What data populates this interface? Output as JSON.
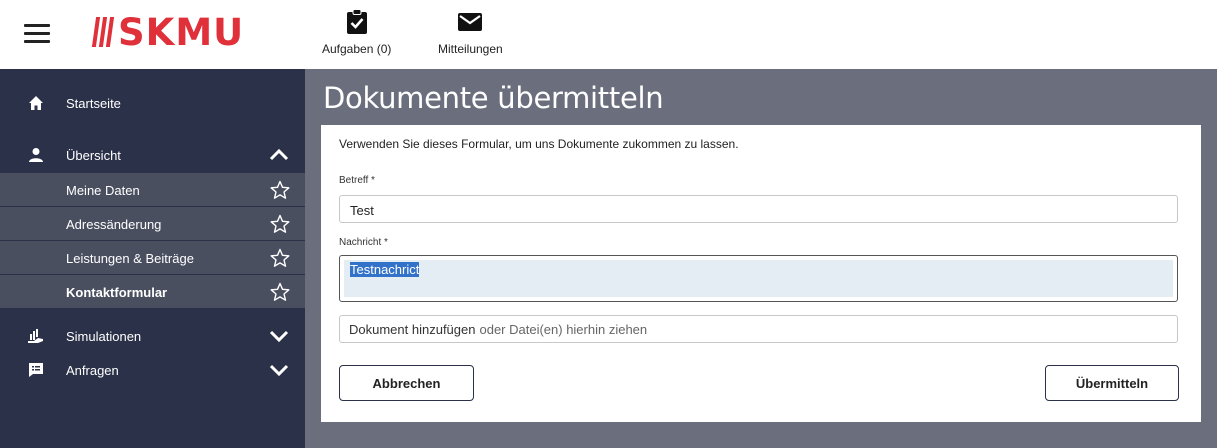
{
  "header": {
    "logo_text": "SKMU",
    "brand_color": "#e0303a",
    "menu_icon": "hamburger-icon",
    "actions": [
      {
        "label": "Aufgaben (0)",
        "icon": "clipboard-check-icon"
      },
      {
        "label": "Mitteilungen",
        "icon": "envelope-icon"
      }
    ]
  },
  "sidebar": {
    "background": "#2b3148",
    "items": [
      {
        "label": "Startseite",
        "icon": "home-icon"
      },
      {
        "label": "Übersicht",
        "icon": "person-icon",
        "expanded": true,
        "children": [
          {
            "label": "Meine Daten",
            "icon": "star-outline-icon"
          },
          {
            "label": "Adressänderung",
            "icon": "star-outline-icon"
          },
          {
            "label": "Leistungen & Beiträge",
            "icon": "star-outline-icon"
          },
          {
            "label": "Kontaktformular",
            "icon": "star-outline-icon",
            "active": true
          }
        ]
      },
      {
        "label": "Simulationen",
        "icon": "chart-hand-icon",
        "expanded": false
      },
      {
        "label": "Anfragen",
        "icon": "message-list-icon",
        "expanded": false
      }
    ]
  },
  "main": {
    "title": "Dokumente übermitteln",
    "intro": "Verwenden Sie dieses Formular, um uns Dokumente zukommen zu lassen.",
    "subject": {
      "label": "Betreff *",
      "value": "Test"
    },
    "message": {
      "label": "Nachricht *",
      "value": "Testnachrict"
    },
    "upload": {
      "primary": "Dokument hinzufügen",
      "secondary": "oder Datei(en) hierhin ziehen"
    },
    "buttons": {
      "cancel": "Abbrechen",
      "submit": "Übermitteln"
    }
  }
}
